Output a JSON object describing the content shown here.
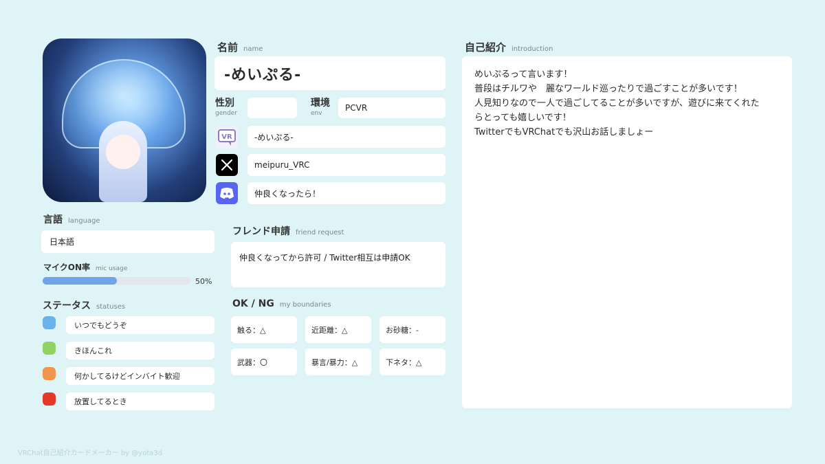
{
  "name": {
    "label": "名前",
    "label_en": "name",
    "value": "-めいぷる-"
  },
  "gender": {
    "label": "性別",
    "label_en": "gender",
    "value": ""
  },
  "env": {
    "label": "環境",
    "label_en": "env",
    "value": "PCVR"
  },
  "accounts": {
    "vrchat": {
      "icon": "vrchat-icon",
      "value": "-めいぷる-"
    },
    "x": {
      "icon": "x-icon",
      "value": "meipuru_VRC"
    },
    "discord": {
      "icon": "discord-icon",
      "value": "仲良くなったら！"
    }
  },
  "language": {
    "label": "言語",
    "label_en": "language",
    "value": "日本語"
  },
  "mic": {
    "label": "マイクON率",
    "label_en": "mic usage",
    "percent": 50,
    "percent_text": "50%"
  },
  "statuses": {
    "label": "ステータス",
    "label_en": "statuses",
    "items": [
      {
        "color": "#6bb1ea",
        "text": "いつでもどうぞ"
      },
      {
        "color": "#8fd461",
        "text": "きほんこれ"
      },
      {
        "color": "#f0964e",
        "text": "何かしてるけどインバイト歓迎"
      },
      {
        "color": "#e5372a",
        "text": "放置してるとき"
      }
    ]
  },
  "friend_request": {
    "label": "フレンド申請",
    "label_en": "friend request",
    "value": "仲良くなってから許可 / Twitter相互は申請OK"
  },
  "boundaries": {
    "label": "OK / NG",
    "label_en": "my boundaries",
    "items": [
      "触る：△",
      "近距離：△",
      "お砂糖：-",
      "武器：〇",
      "暴言/暴力：△",
      "下ネタ：△"
    ]
  },
  "intro": {
    "label": "自己紹介",
    "label_en": "introduction",
    "lines": [
      "めいぷるって言います！",
      "普段はチルワや　麗なワールド巡ったりで過ごすことが多いです！",
      "人見知りなので一人で過ごしてることが多いですが、遊びに来てくれた",
      "らとっても嬉しいです！",
      "TwitterでもVRChatでも沢山お話しましょー"
    ]
  },
  "footer": "VRChat自己紹介カードメーカー by @yota3d"
}
